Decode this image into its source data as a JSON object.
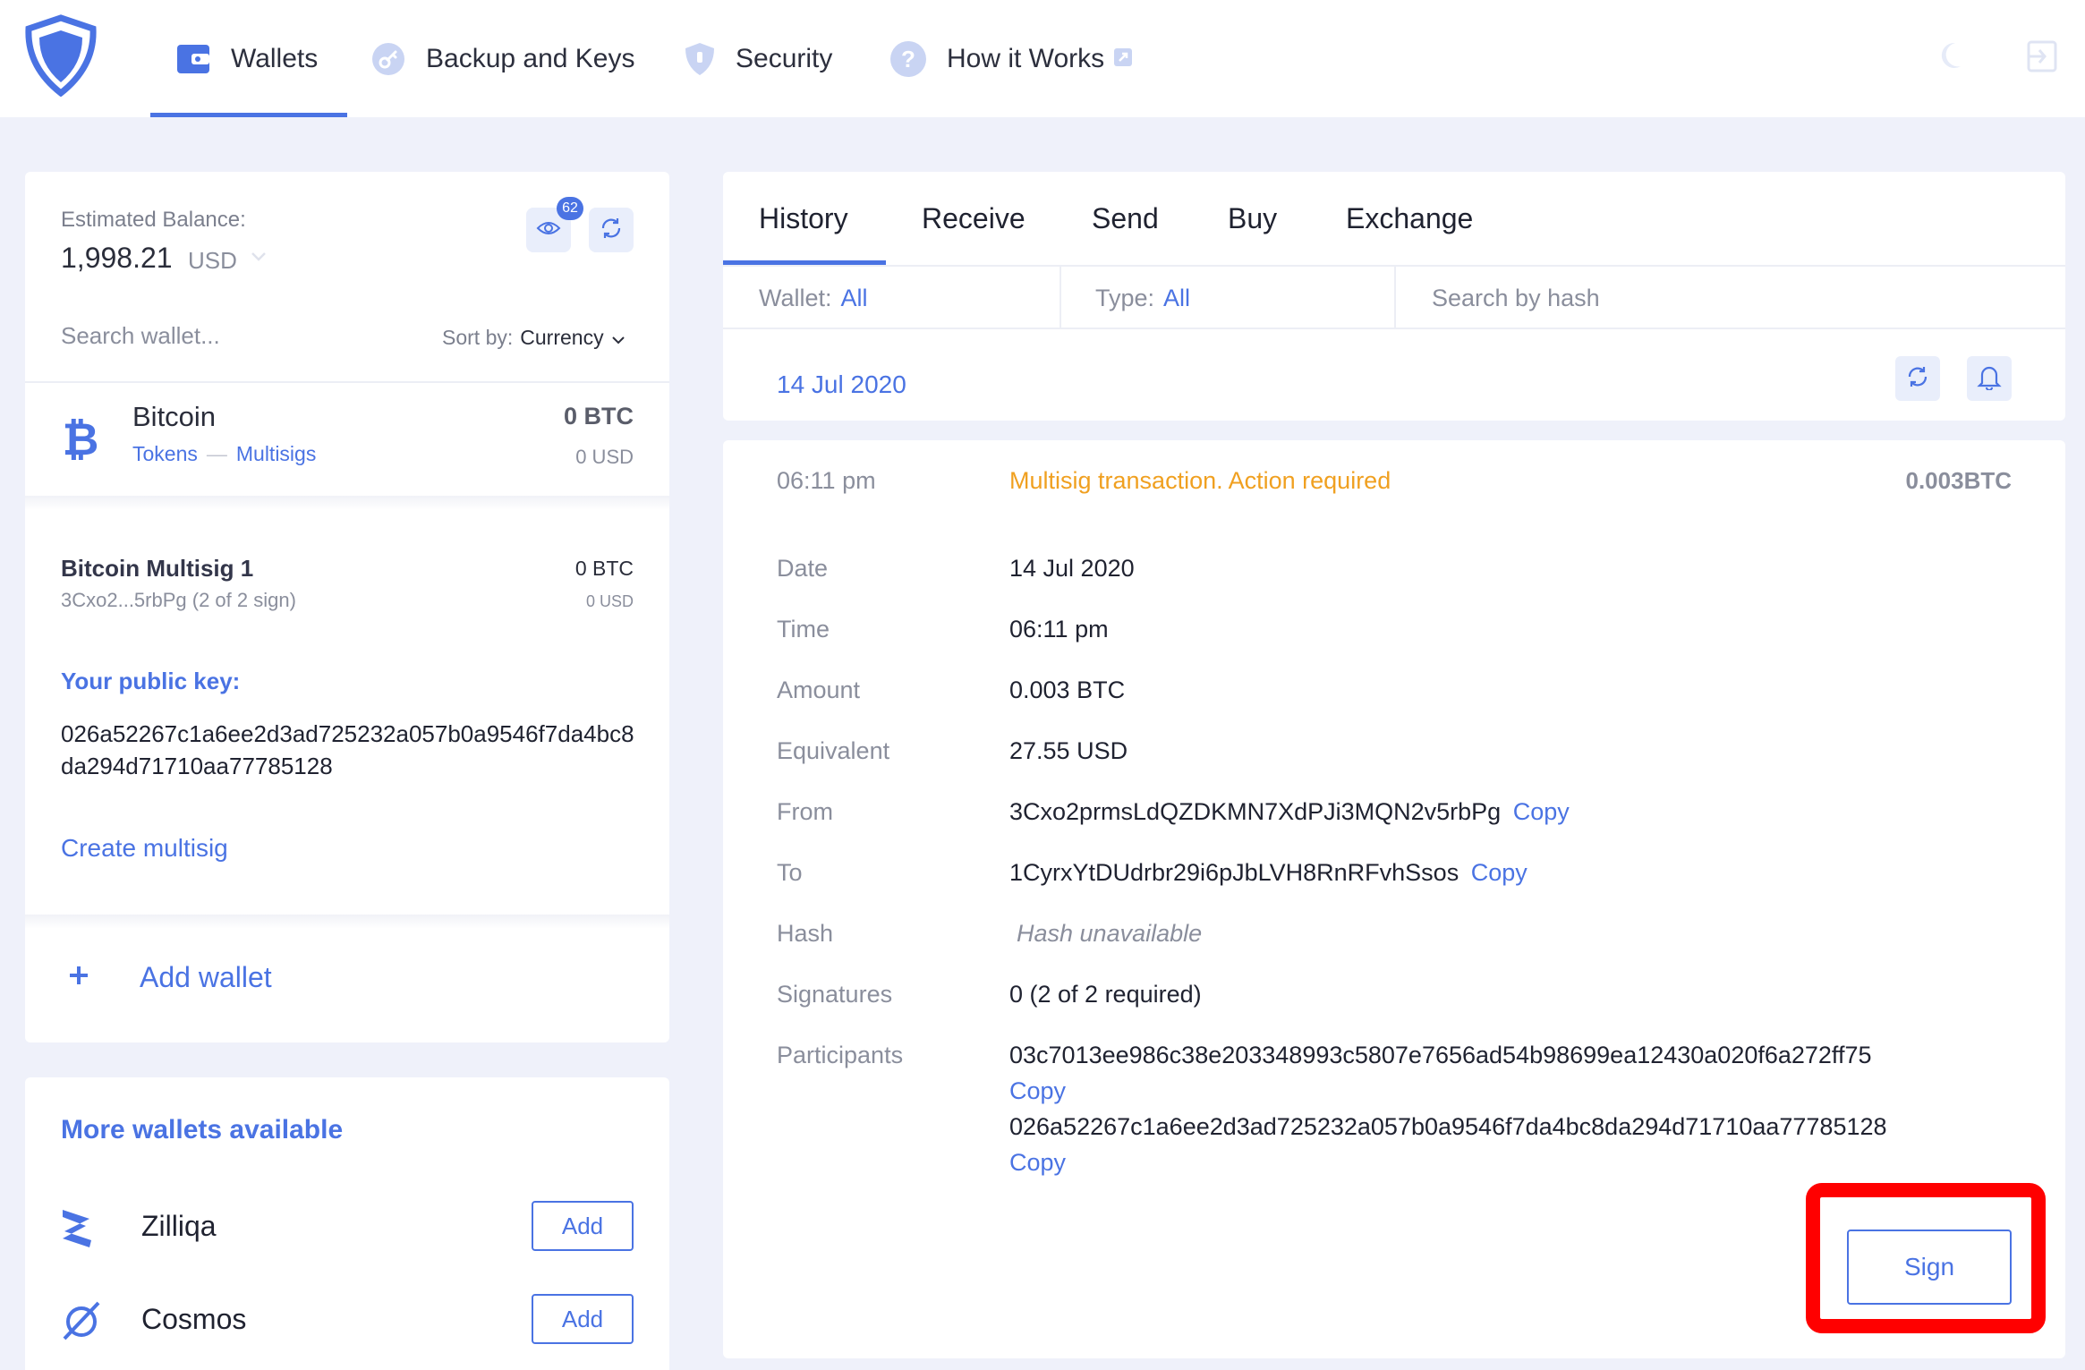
{
  "nav": {
    "items": [
      {
        "label": "Wallets",
        "icon": "wallet-icon"
      },
      {
        "label": "Backup and Keys",
        "icon": "key-icon"
      },
      {
        "label": "Security",
        "icon": "shield-icon"
      },
      {
        "label": "How it Works",
        "icon": "question-icon"
      }
    ],
    "active": "Wallets"
  },
  "colors": {
    "accent": "#4a73e3",
    "warning": "#f0a020",
    "highlight": "#ff0000",
    "background": "#eff1fa"
  },
  "balance": {
    "label": "Estimated Balance:",
    "value": "1,998.21",
    "currency": "USD",
    "badge_count": "62"
  },
  "wallet_list": {
    "search_placeholder": "Search wallet...",
    "sort_label": "Sort by:",
    "sort_value": "Currency",
    "bitcoin": {
      "name": "Bitcoin",
      "link_tokens": "Tokens",
      "link_multisigs": "Multisigs",
      "amount": "0 BTC",
      "usd": "0 USD"
    },
    "multisig": {
      "name": "Bitcoin Multisig 1",
      "address": "3Cxo2...5rbPg  (2 of 2 sign)",
      "amount": "0 BTC",
      "usd": "0 USD",
      "public_key_label": "Your public key:",
      "public_key": "026a52267c1a6ee2d3ad725232a057b0a9546f7da4bc8da294d71710aa77785128",
      "create_label": "Create multisig"
    },
    "add_wallet_label": "Add wallet"
  },
  "more_wallets": {
    "title": "More wallets available",
    "items": [
      {
        "name": "Zilliqa",
        "button": "Add",
        "icon": "zilliqa-icon"
      },
      {
        "name": "Cosmos",
        "button": "Add",
        "icon": "cosmos-icon"
      }
    ]
  },
  "tabs": [
    "History",
    "Receive",
    "Send",
    "Buy",
    "Exchange"
  ],
  "active_tab": "History",
  "filters": {
    "wallet_label": "Wallet:",
    "wallet_value": "All",
    "type_label": "Type:",
    "type_value": "All",
    "hash_placeholder": "Search by hash"
  },
  "history": {
    "date_heading": "14 Jul 2020",
    "tx": {
      "time": "06:11 pm",
      "status": "Multisig transaction. Action required",
      "amount": "0.003BTC",
      "details": [
        {
          "label": "Date",
          "value": "14 Jul 2020"
        },
        {
          "label": "Time",
          "value": "06:11 pm"
        },
        {
          "label": "Amount",
          "value": "0.003 BTC"
        },
        {
          "label": "Equivalent",
          "value": "27.55 USD"
        },
        {
          "label": "From",
          "value": "3Cxo2prmsLdQZDKMN7XdPJi3MQN2v5rbPg",
          "copy": "Copy"
        },
        {
          "label": "To",
          "value": "1CyrxYtDUdrbr29i6pJbLVH8RnRFvhSsos",
          "copy": "Copy"
        },
        {
          "label": "Hash",
          "value": "Hash unavailable"
        },
        {
          "label": "Signatures",
          "value": "0 (2 of 2 required)"
        }
      ],
      "participants_label": "Participants",
      "participants": [
        {
          "key": "03c7013ee986c38e203348993c5807e7656ad54b98699ea12430a020f6a272ff75",
          "copy": "Copy"
        },
        {
          "key": "026a52267c1a6ee2d3ad725232a057b0a9546f7da4bc8da294d71710aa77785128",
          "copy": "Copy"
        }
      ],
      "sign_label": "Sign"
    }
  }
}
